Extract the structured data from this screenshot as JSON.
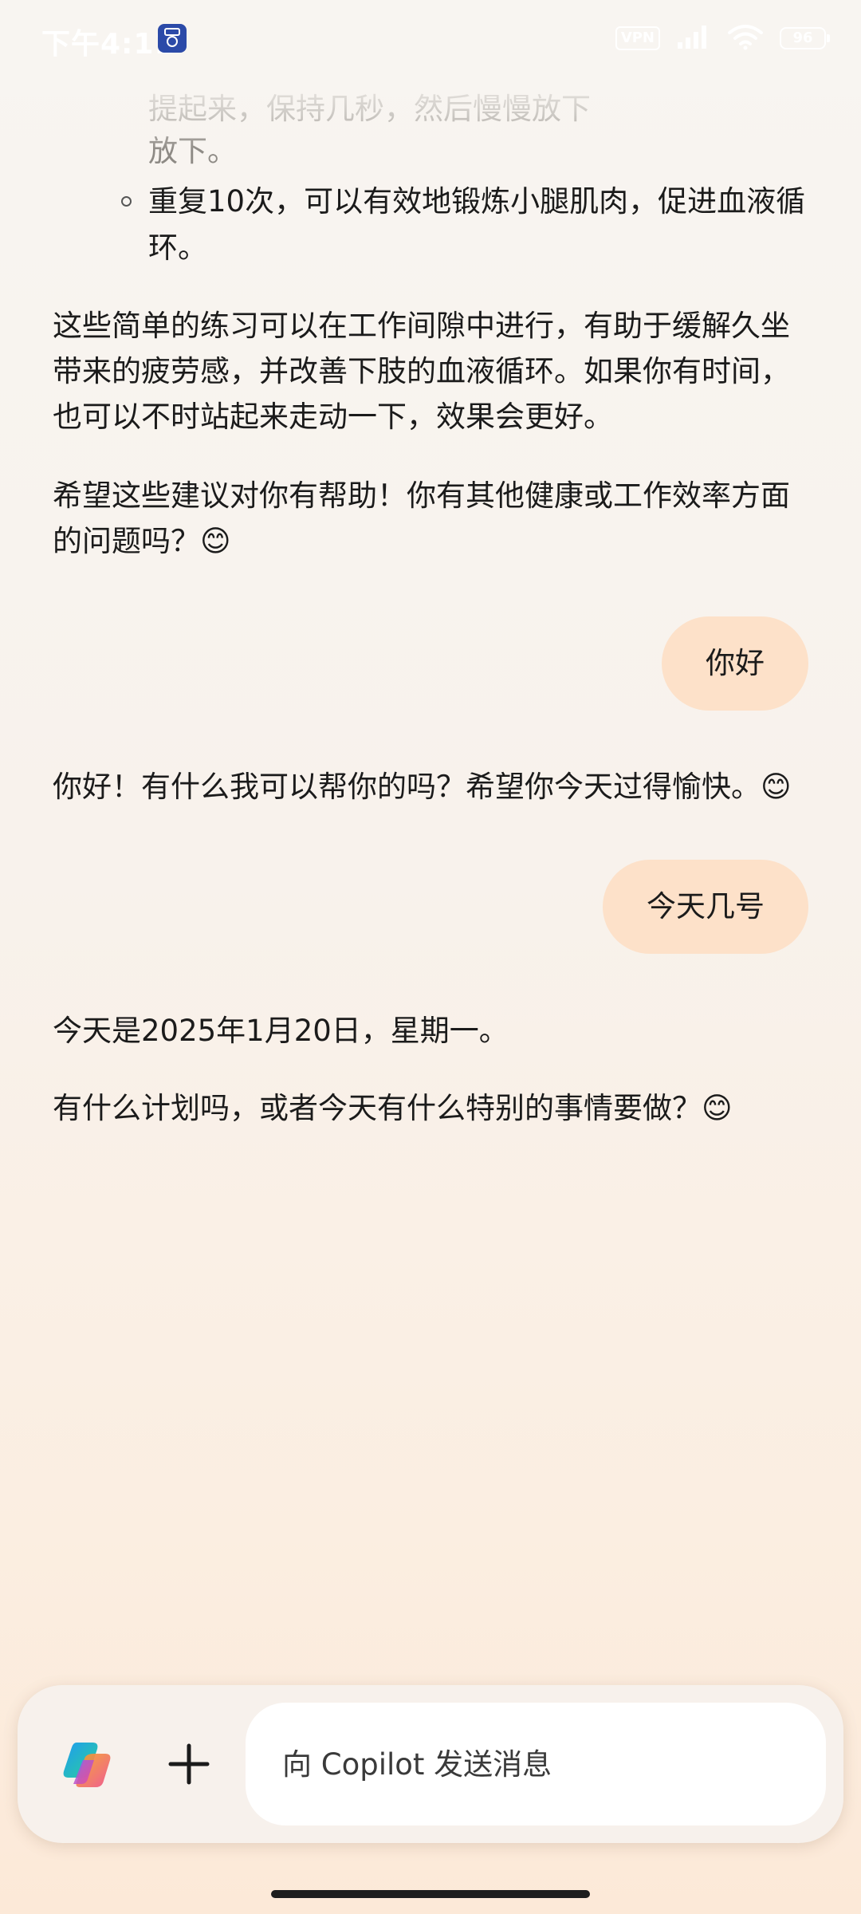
{
  "status_bar": {
    "time": "下午4:11",
    "vpn_label": "VPN",
    "battery_level": "96",
    "icons": [
      "app-badge-icon",
      "vpn-icon",
      "signal-icon",
      "wifi-icon",
      "battery-icon"
    ]
  },
  "chat": {
    "prev_tail": {
      "partial_line": "提起来，保持几秒，然后慢慢放下",
      "line2": "放下。",
      "bullet_line1": "重复10次，可以有效地锻炼小腿肌肉，促进血液循",
      "bullet_line2": "环。"
    },
    "paragraph1": [
      "这些简单的练习可以在工作间隙中进行，有助于缓解久坐",
      "带来的疲劳感，并改善下肢的血液循环。如果你有时间，",
      "也可以不时站起来走动一下，效果会更好。"
    ],
    "paragraph2": [
      "希望这些建议对你有帮助！你有其他健康或工作效率方面",
      "的问题吗？😊"
    ],
    "user_message_1": "你好",
    "assistant_reply_1": "你好！有什么我可以帮你的吗？希望你今天过得愉快。😊",
    "user_message_2": "今天几号",
    "assistant_reply_2": {
      "line1": "今天是2025年1月20日，星期一。",
      "line2": "有什么计划吗，或者今天有什么特别的事情要做？😊"
    }
  },
  "composer": {
    "logo_icon": "copilot-logo-icon",
    "plus_icon": "plus-icon",
    "placeholder": "向 Copilot 发送消息",
    "value": ""
  },
  "colors": {
    "user_bubble": "#fde1c9",
    "background_top": "#f8f5f1",
    "background_bottom": "#fce9d8"
  }
}
